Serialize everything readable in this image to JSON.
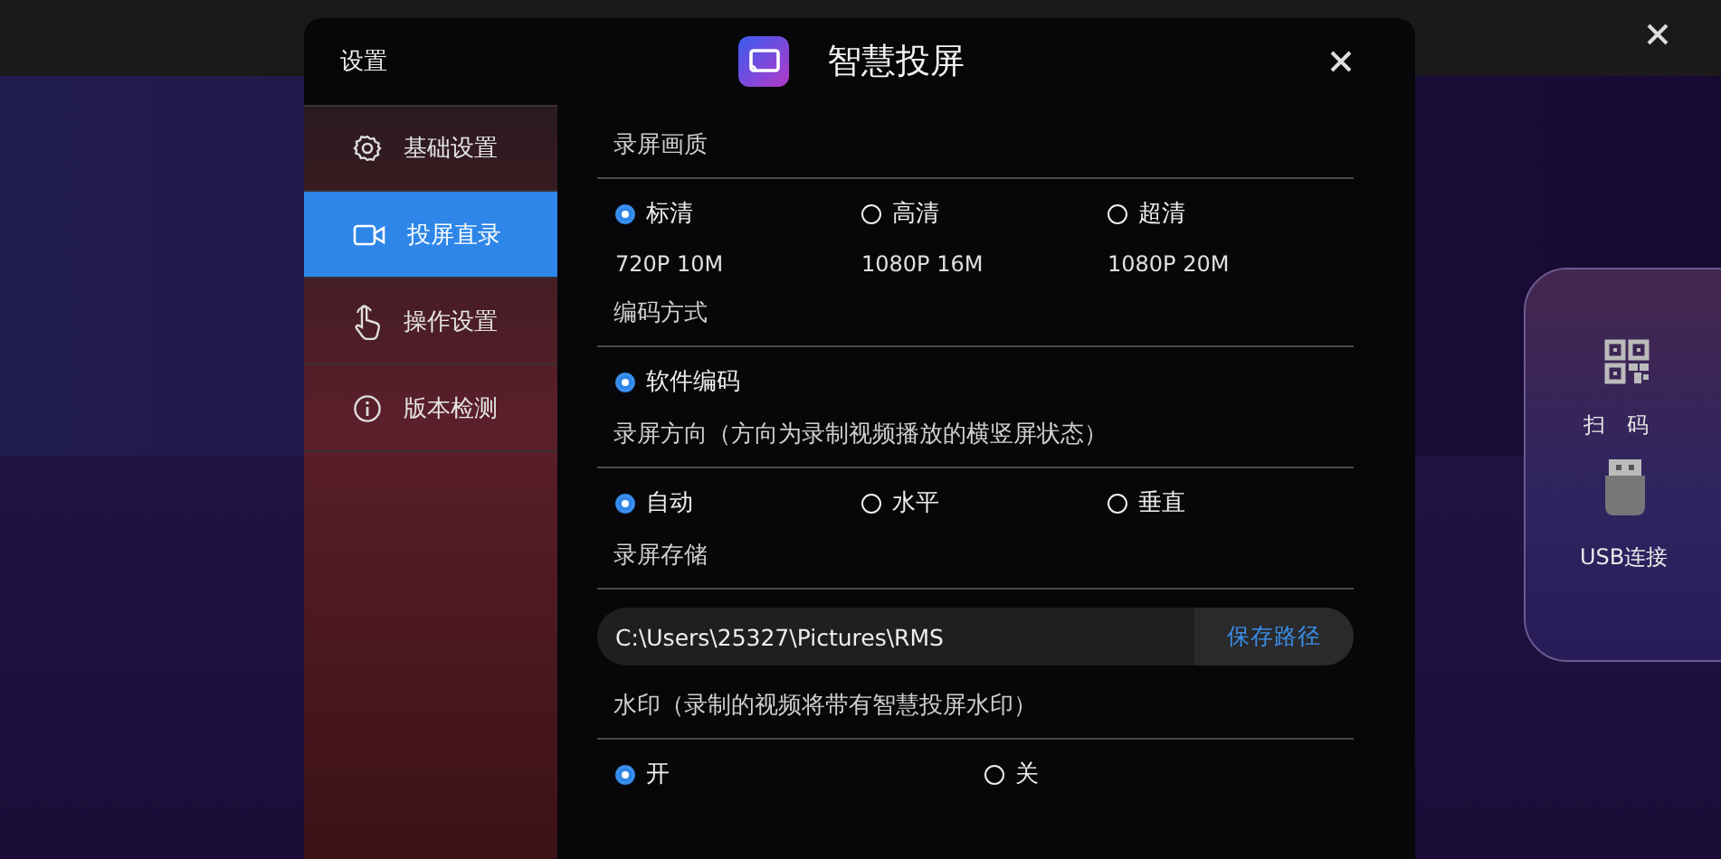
{
  "side_card": {
    "items": [
      {
        "kind": "qr",
        "label": "扫　码"
      },
      {
        "kind": "usb",
        "label": "USB连接"
      }
    ]
  },
  "dialog": {
    "title": "设置",
    "app_name": "智慧投屏",
    "sidebar": [
      {
        "kind": "gear",
        "label": "基础设置",
        "selected": false
      },
      {
        "kind": "camera",
        "label": "投屏直录",
        "selected": true
      },
      {
        "kind": "hand",
        "label": "操作设置",
        "selected": false
      },
      {
        "kind": "info",
        "label": "版本检测",
        "selected": false
      }
    ],
    "sections": [
      {
        "kind": "radios",
        "title": "录屏画质",
        "options": [
          {
            "label": "标清",
            "detail": "720P 10M",
            "selected": true
          },
          {
            "label": "高清",
            "detail": "1080P 16M",
            "selected": false
          },
          {
            "label": "超清",
            "detail": "1080P 20M",
            "selected": false
          }
        ]
      },
      {
        "kind": "radios",
        "title": "编码方式",
        "options": [
          {
            "label": "软件编码",
            "selected": true
          }
        ]
      },
      {
        "kind": "radios",
        "title": "录屏方向（方向为录制视频播放的横竖屏状态）",
        "options": [
          {
            "label": "自动",
            "selected": true
          },
          {
            "label": "水平",
            "selected": false
          },
          {
            "label": "垂直",
            "selected": false
          }
        ]
      },
      {
        "kind": "path",
        "title": "录屏存储",
        "value": "C:\\Users\\25327\\Pictures\\RMS",
        "button": "保存路径"
      },
      {
        "kind": "radios",
        "title": "水印（录制的视频将带有智慧投屏水印）",
        "options": [
          {
            "label": "开",
            "selected": true
          },
          {
            "label": "关",
            "selected": false
          }
        ]
      }
    ]
  }
}
